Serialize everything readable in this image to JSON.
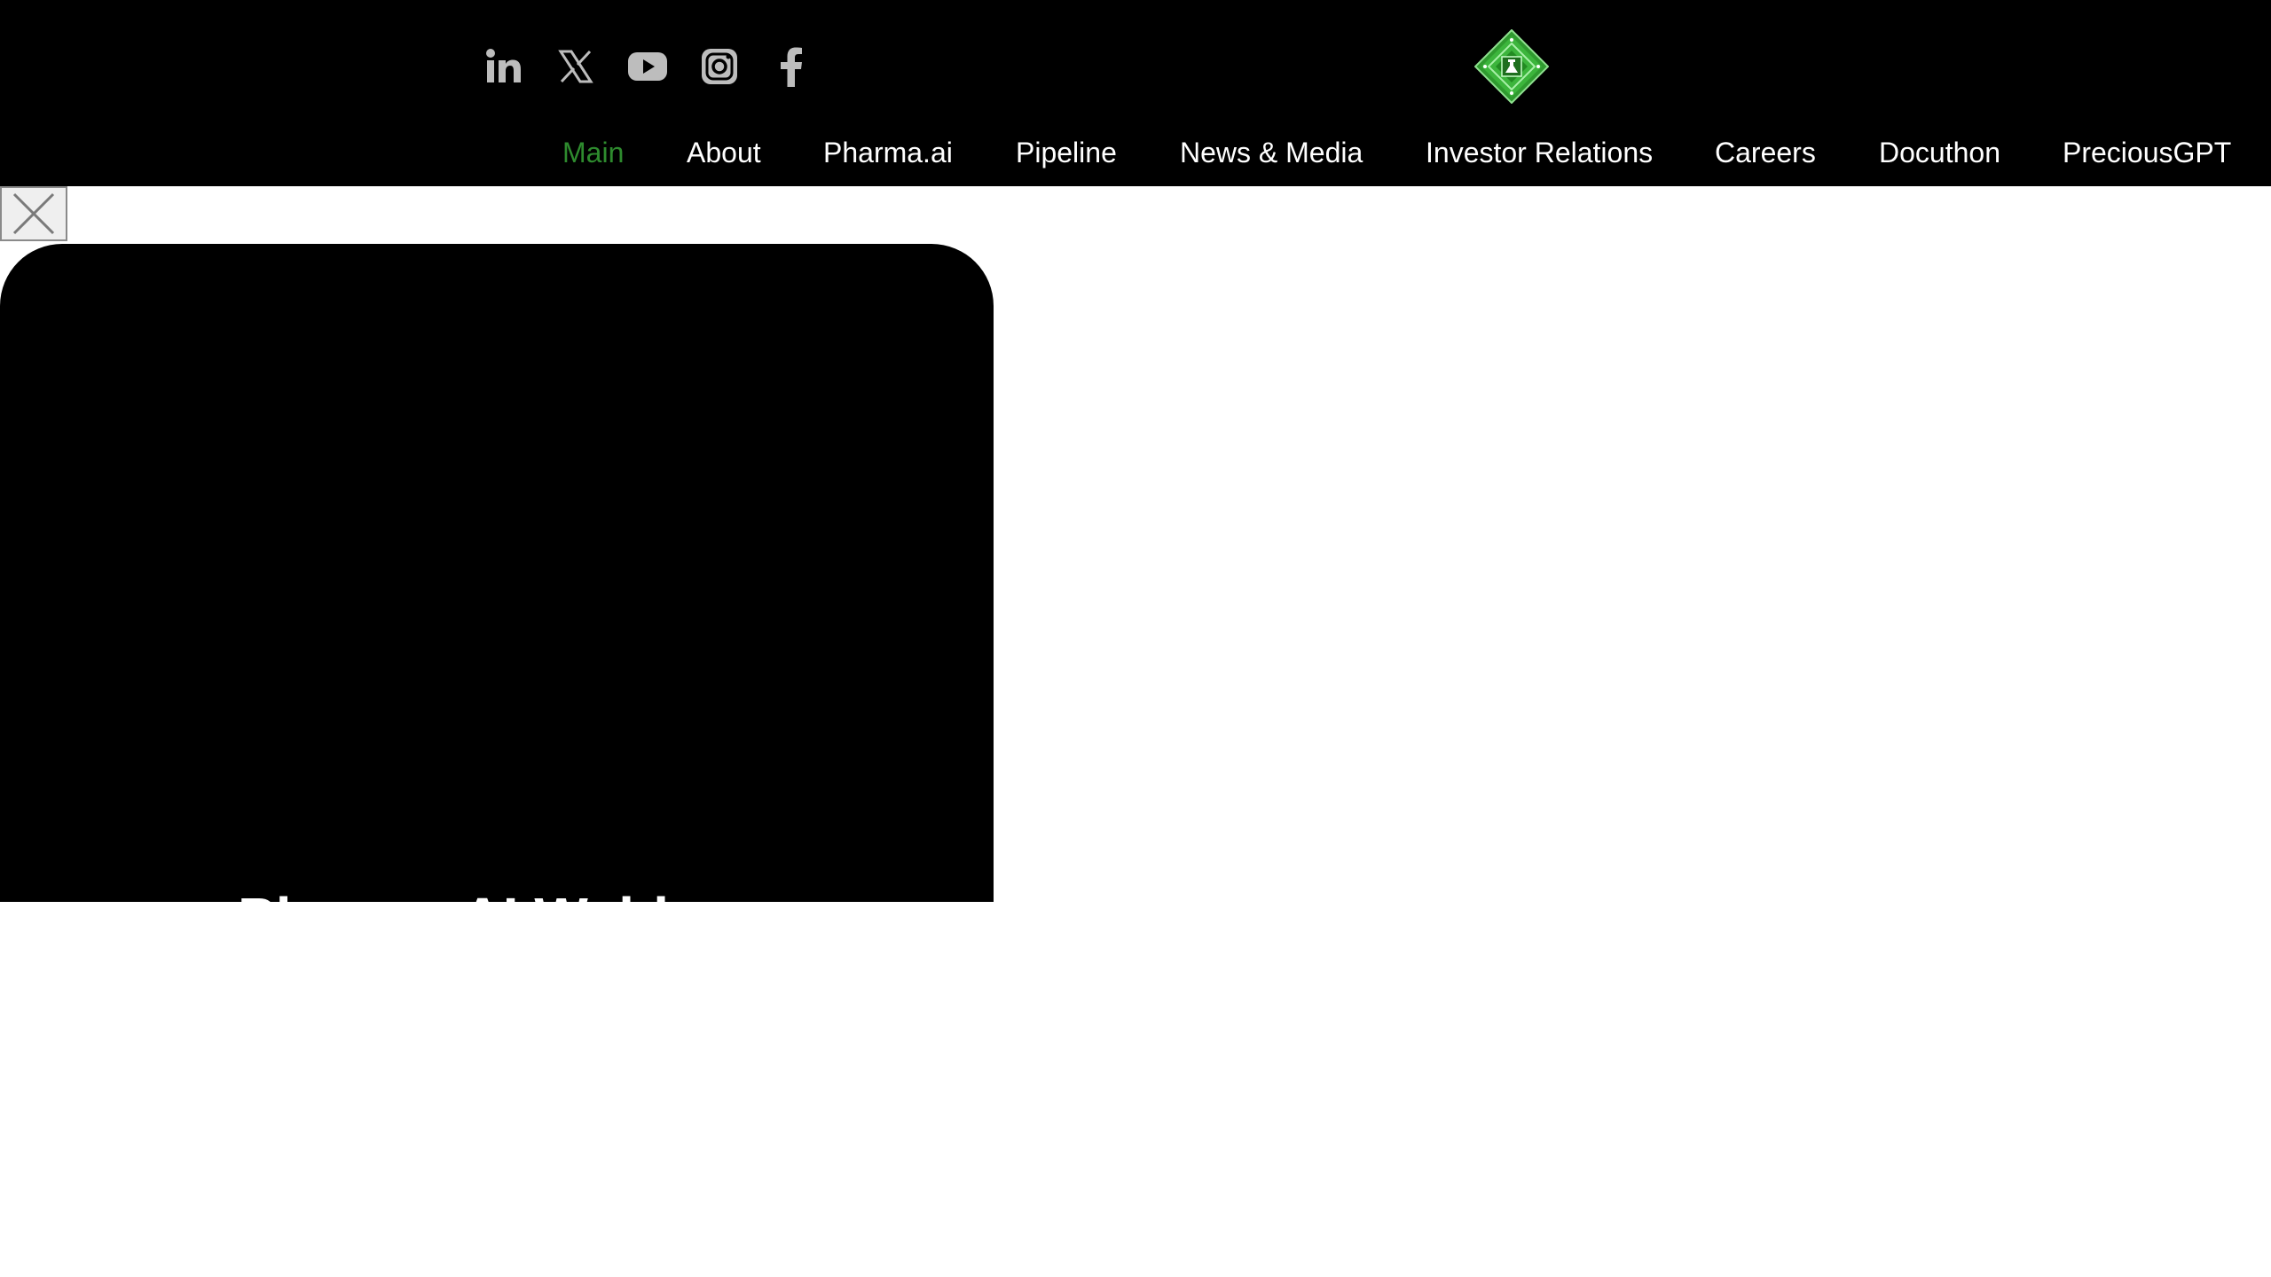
{
  "header": {
    "socials": [
      {
        "icon": "linkedin-icon"
      },
      {
        "icon": "x-twitter-icon"
      },
      {
        "icon": "youtube-icon"
      },
      {
        "icon": "instagram-icon"
      },
      {
        "icon": "facebook-icon"
      }
    ],
    "logo_icon": "insilico-diamond-logo",
    "nav": [
      {
        "label": "Main",
        "active": true
      },
      {
        "label": "About"
      },
      {
        "label": "Pharma.ai"
      },
      {
        "label": "Pipeline"
      },
      {
        "label": "News & Media"
      },
      {
        "label": "Investor Relations"
      },
      {
        "label": "Careers"
      },
      {
        "label": "Docuthon"
      },
      {
        "label": "PreciousGPT"
      }
    ]
  },
  "popup": {
    "close_icon": "close-icon",
    "hero_title": "Pharma.AI Webinar"
  },
  "colors": {
    "header_bg": "#000000",
    "active_nav": "#2e8b2e",
    "nav_text": "#ffffff",
    "social_icon": "#bdbdbd",
    "logo_green": "#3cb53c"
  }
}
